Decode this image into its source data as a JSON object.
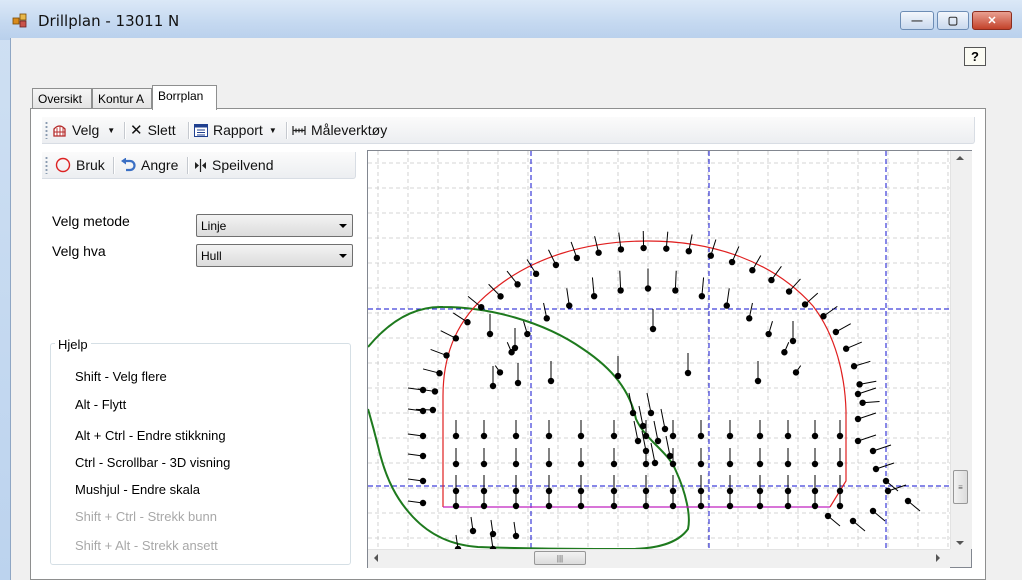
{
  "window": {
    "title": "Drillplan - 13011 N"
  },
  "titlebar_buttons": {
    "minimize": "—",
    "maximize": "▢",
    "close": "✕"
  },
  "help_button": "?",
  "tabs": [
    {
      "label": "Oversikt",
      "active": false
    },
    {
      "label": "Kontur A",
      "active": false
    },
    {
      "label": "Borrplan",
      "active": true
    }
  ],
  "toolbar": {
    "velg": "Velg",
    "slett": "Slett",
    "rapport": "Rapport",
    "maleverktoy": "Måleverktøy"
  },
  "toolbar2": {
    "bruk": "Bruk",
    "angre": "Angre",
    "speilvend": "Speilvend"
  },
  "form": {
    "velg_metode_label": "Velg metode",
    "velg_metode_value": "Linje",
    "velg_hva_label": "Velg hva",
    "velg_hva_value": "Hull"
  },
  "help": {
    "title": "Hjelp",
    "lines": [
      {
        "text": "Shift - Velg flere",
        "enabled": true
      },
      {
        "text": "Alt - Flytt",
        "enabled": true
      },
      {
        "text": "Alt + Ctrl - Endre stikkning",
        "enabled": true
      },
      {
        "text": "Ctrl - Scrollbar - 3D visning",
        "enabled": true
      },
      {
        "text": "Mushjul - Endre skala",
        "enabled": true
      },
      {
        "text": "Shift + Ctrl - Strekk bunn",
        "enabled": false
      },
      {
        "text": "Shift  + Alt - Strekk ansett",
        "enabled": false
      }
    ]
  },
  "colors": {
    "contour": "#e02020",
    "floor_line": "#c020c0",
    "green_outline": "#1e7a1e",
    "blue_axes": "#1010d0",
    "grid": "#c8c8c8",
    "hole": "#000000"
  }
}
